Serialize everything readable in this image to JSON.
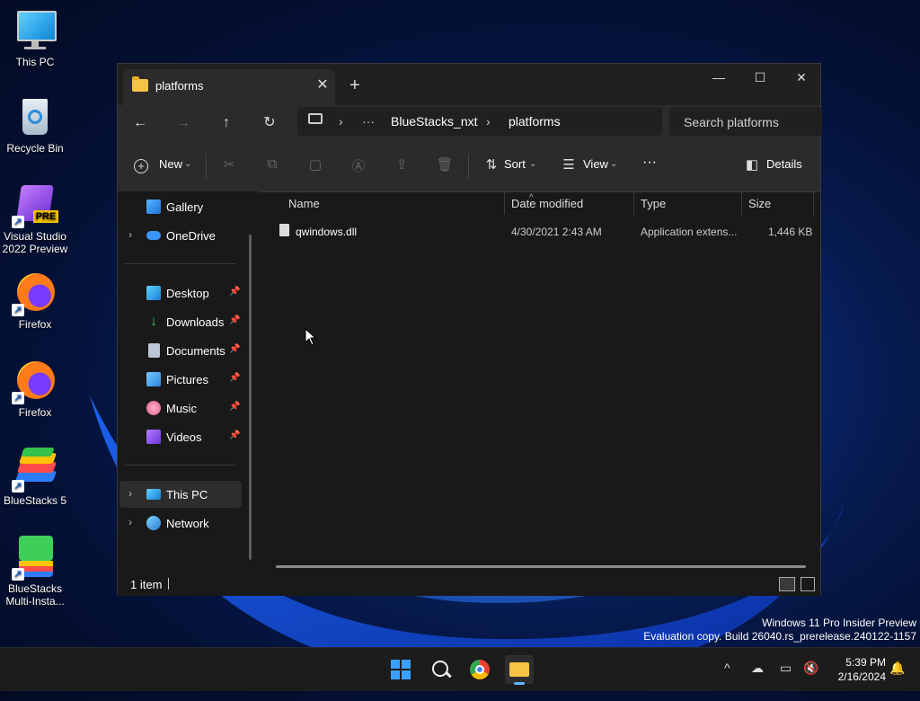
{
  "desktop": {
    "icons": [
      {
        "label": "This PC",
        "icon": "monitor-icon"
      },
      {
        "label": "Recycle Bin",
        "icon": "recycle-bin-icon"
      },
      {
        "label": "Visual Studio 2022 Preview",
        "badge": "PRE",
        "icon": "visual-studio-icon"
      },
      {
        "label": "Firefox",
        "icon": "firefox-icon"
      },
      {
        "label": "Firefox",
        "icon": "firefox-icon"
      },
      {
        "label": "BlueStacks 5",
        "icon": "bluestacks-icon"
      },
      {
        "label": "BlueStacks Multi-Insta...",
        "icon": "bluestacks-multi-icon"
      }
    ],
    "shortcut_arrow": "↗",
    "watermark": {
      "line1": "Windows 11 Pro Insider Preview",
      "line2": "Evaluation copy. Build 26040.rs_prerelease.240122-1157"
    }
  },
  "explorer": {
    "tab_title": "platforms",
    "tab_close": "✕",
    "tab_add": "+",
    "window_controls": {
      "minimize": "—",
      "maximize": "☐",
      "close": "✕"
    },
    "nav": {
      "back": "←",
      "forward": "→",
      "up": "↑",
      "refresh": "↻"
    },
    "address": {
      "chevron": "›",
      "ellipsis": "···",
      "segments": [
        "BlueStacks_nxt",
        "platforms"
      ]
    },
    "search_placeholder": "Search platforms",
    "toolbar": {
      "new_label": "New",
      "sort_label": "Sort",
      "view_label": "View",
      "more_label": "···",
      "details_label": "Details",
      "caret": "⌄"
    },
    "sidebar": {
      "items": [
        {
          "label": "Gallery",
          "icon": "gallery-icon"
        },
        {
          "label": "OneDrive",
          "icon": "onedrive-icon",
          "expandable": true
        },
        {
          "label": "Desktop",
          "icon": "desktop-icon",
          "pinned": true
        },
        {
          "label": "Downloads",
          "icon": "downloads-icon",
          "pinned": true
        },
        {
          "label": "Documents",
          "icon": "documents-icon",
          "pinned": true
        },
        {
          "label": "Pictures",
          "icon": "pictures-icon",
          "pinned": true
        },
        {
          "label": "Music",
          "icon": "music-icon",
          "pinned": true
        },
        {
          "label": "Videos",
          "icon": "videos-icon",
          "pinned": true
        },
        {
          "label": "This PC",
          "icon": "this-pc-icon",
          "expandable": true,
          "selected": true
        },
        {
          "label": "Network",
          "icon": "network-icon",
          "expandable": true
        }
      ],
      "chevron": "›",
      "pin": "📌"
    },
    "columns": [
      "Name",
      "Date modified",
      "Type",
      "Size"
    ],
    "sort_indicator": "^",
    "files": [
      {
        "name": "qwindows.dll",
        "date": "4/30/2021 2:43 AM",
        "type": "Application extens...",
        "size": "1,446 KB"
      }
    ],
    "status": {
      "count": "1 item"
    }
  },
  "taskbar": {
    "tray_chevron": "^",
    "time": "5:39 PM",
    "date": "2/16/2024"
  },
  "colors": {
    "accent": "#0078d4",
    "window_bg": "#191919",
    "toolbar_bg": "#2b2b2b",
    "folder_yellow": "#f6c343"
  }
}
